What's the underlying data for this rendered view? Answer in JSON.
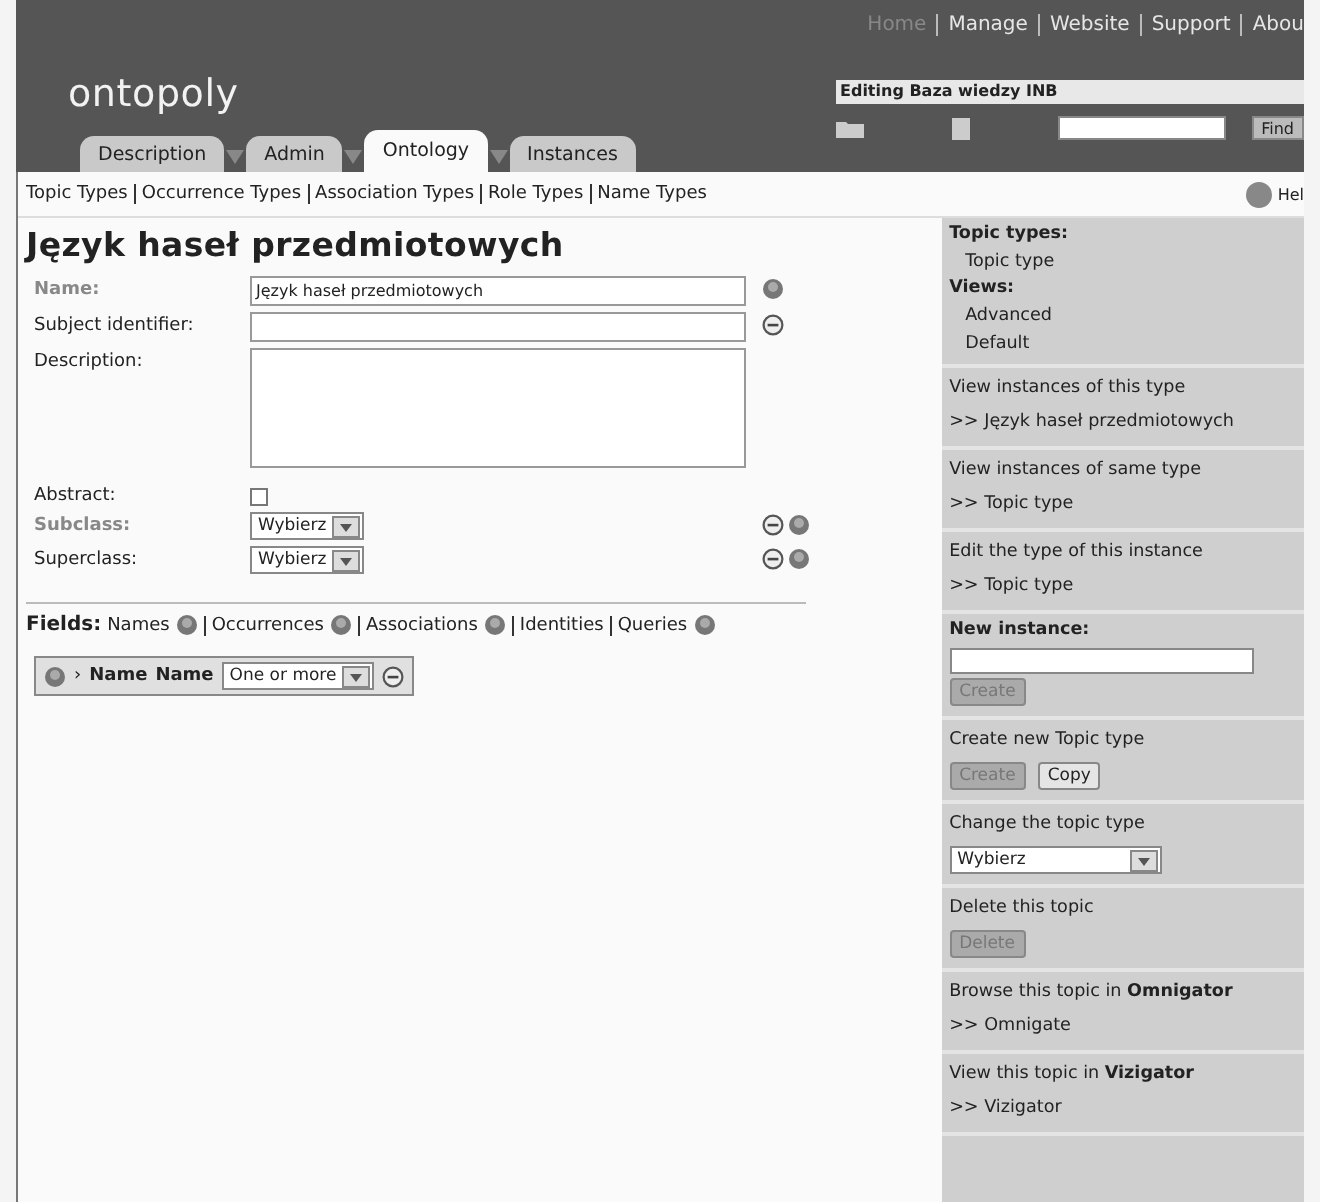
{
  "header": {
    "logo": "ontopoly",
    "top_links": [
      {
        "label": "Home",
        "selected": true
      },
      {
        "label": "Manage",
        "selected": false
      },
      {
        "label": "Website",
        "selected": false
      },
      {
        "label": "Support",
        "selected": false
      },
      {
        "label": "Abou",
        "selected": false
      }
    ],
    "editing": "Editing Baza wiedzy INB",
    "find_button": "Find"
  },
  "tabs": [
    {
      "label": "Description",
      "selected": false
    },
    {
      "label": "Admin",
      "selected": false
    },
    {
      "label": "Ontology",
      "selected": true
    },
    {
      "label": "Instances",
      "selected": false
    }
  ],
  "subnav": [
    "Topic Types",
    "Occurrence Types",
    "Association Types",
    "Role Types",
    "Name Types"
  ],
  "help": "Hel",
  "title": "Język haseł przedmiotowych",
  "fields": [
    {
      "kind": "text",
      "label": "Name:",
      "dimmed": true,
      "value": "Język haseł przedmiotowych",
      "remove": false,
      "add": true
    },
    {
      "kind": "text",
      "label": "Subject identifier:",
      "dimmed": false,
      "remove": true,
      "add": false
    },
    {
      "kind": "textarea",
      "label": "Description:",
      "dimmed": false,
      "remove": false,
      "add": false
    },
    {
      "kind": "checkbox",
      "label": "Abstract:",
      "dimmed": false,
      "checked": false,
      "remove": false,
      "add": false
    },
    {
      "kind": "select",
      "label": "Subclass:",
      "dimmed": true,
      "value": "Wybierz",
      "remove": true,
      "add": true
    },
    {
      "kind": "select",
      "label": "Superclass:",
      "dimmed": false,
      "value": "Wybierz",
      "remove": true,
      "add": true
    }
  ],
  "fields_bar": {
    "label": "Fields:",
    "items": [
      {
        "label": "Names",
        "has_add": true
      },
      {
        "label": "Occurrences",
        "has_add": true
      },
      {
        "label": "Associations",
        "has_add": true
      },
      {
        "label": "Identities",
        "has_add": false
      },
      {
        "label": "Queries",
        "has_add": true
      }
    ]
  },
  "name_field": {
    "marker": "›",
    "name": "Name",
    "type": "Name",
    "cardinality": "One or more"
  },
  "sidebar": [
    {
      "items": [
        {
          "kind": "heading",
          "text": "Topic types:"
        },
        {
          "kind": "entry",
          "text": "Topic type"
        },
        {
          "kind": "heading",
          "text": "Views:"
        },
        {
          "kind": "entry",
          "text": "Advanced"
        },
        {
          "kind": "entry",
          "text": "Default"
        }
      ]
    },
    {
      "items": [
        {
          "kind": "caption",
          "text": "View instances of this type"
        },
        {
          "kind": "link",
          "text": ">> Język haseł przedmiotowych"
        }
      ]
    },
    {
      "items": [
        {
          "kind": "caption",
          "text": "View instances of same type"
        },
        {
          "kind": "link",
          "text": ">> Topic type"
        }
      ]
    },
    {
      "items": [
        {
          "kind": "caption",
          "text": "Edit the type of this instance"
        },
        {
          "kind": "link",
          "text": ">> Topic type"
        }
      ]
    },
    {
      "items": [
        {
          "kind": "heading",
          "text": "New instance:"
        },
        {
          "kind": "input"
        },
        {
          "kind": "buttons",
          "buttons": [
            {
              "label": "Create",
              "disabled": true
            }
          ]
        }
      ]
    },
    {
      "items": [
        {
          "kind": "caption",
          "text": "Create new Topic type"
        },
        {
          "kind": "buttons",
          "buttons": [
            {
              "label": "Create",
              "disabled": true
            },
            {
              "label": "Copy",
              "disabled": false
            }
          ]
        }
      ]
    },
    {
      "items": [
        {
          "kind": "caption",
          "text": "Change the topic type"
        },
        {
          "kind": "select",
          "text": "Wybierz"
        }
      ]
    },
    {
      "items": [
        {
          "kind": "caption",
          "text": "Delete this topic"
        },
        {
          "kind": "buttons",
          "buttons": [
            {
              "label": "Delete",
              "disabled": true
            }
          ]
        }
      ]
    },
    {
      "items": [
        {
          "kind": "caption",
          "text": "Browse this topic in **Omnigator**"
        },
        {
          "kind": "link",
          "text": ">> Omnigate"
        }
      ]
    },
    {
      "items": [
        {
          "kind": "caption",
          "text": "View this topic in **Vizigator**"
        },
        {
          "kind": "link",
          "text": ">> Vizigator"
        }
      ]
    }
  ]
}
